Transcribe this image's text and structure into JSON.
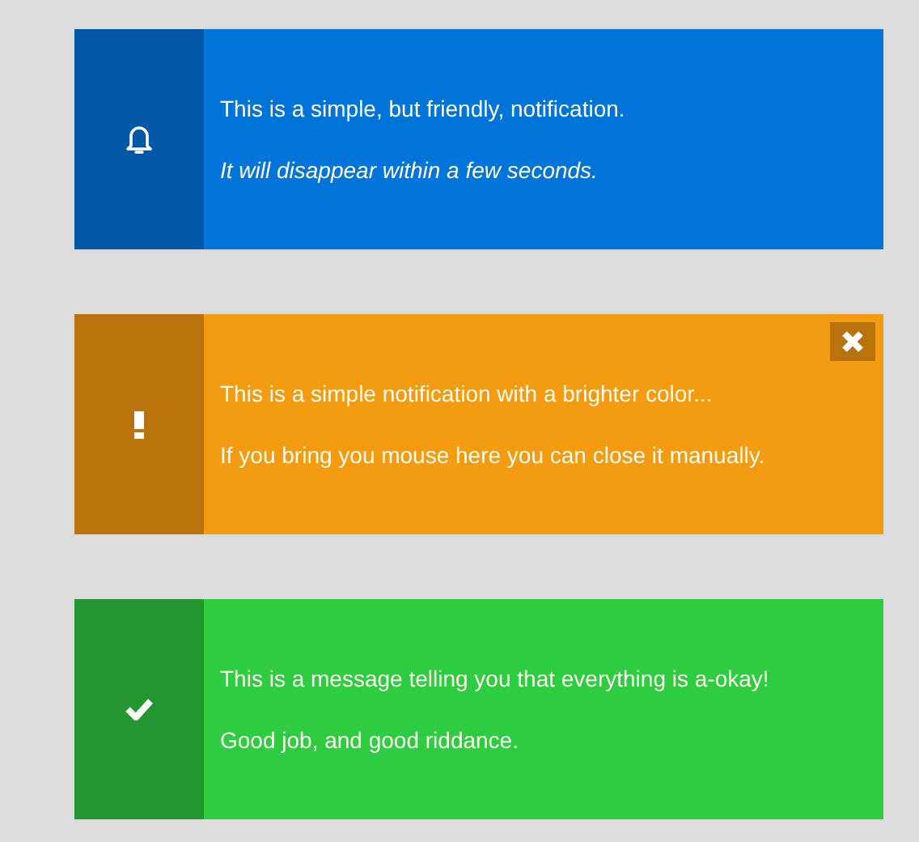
{
  "notifications": [
    {
      "kind": "info",
      "color": "#0074d9",
      "closable": false,
      "lines": [
        {
          "text": "This is a simple, but friendly, notification.",
          "italic": false
        },
        {
          "text": "It will disappear within a few seconds.",
          "italic": true
        }
      ]
    },
    {
      "kind": "warning",
      "color": "#f39c12",
      "closable": true,
      "lines": [
        {
          "text": "This is a simple notification with a brighter color...",
          "italic": false
        },
        {
          "text": "If you bring you mouse here you can close it manually.",
          "italic": false
        }
      ]
    },
    {
      "kind": "success",
      "color": "#2ecc40",
      "closable": false,
      "lines": [
        {
          "text": "This is a message telling you that everything is a-okay!",
          "italic": false
        },
        {
          "text": "Good job, and good riddance.",
          "italic": false
        }
      ]
    }
  ]
}
